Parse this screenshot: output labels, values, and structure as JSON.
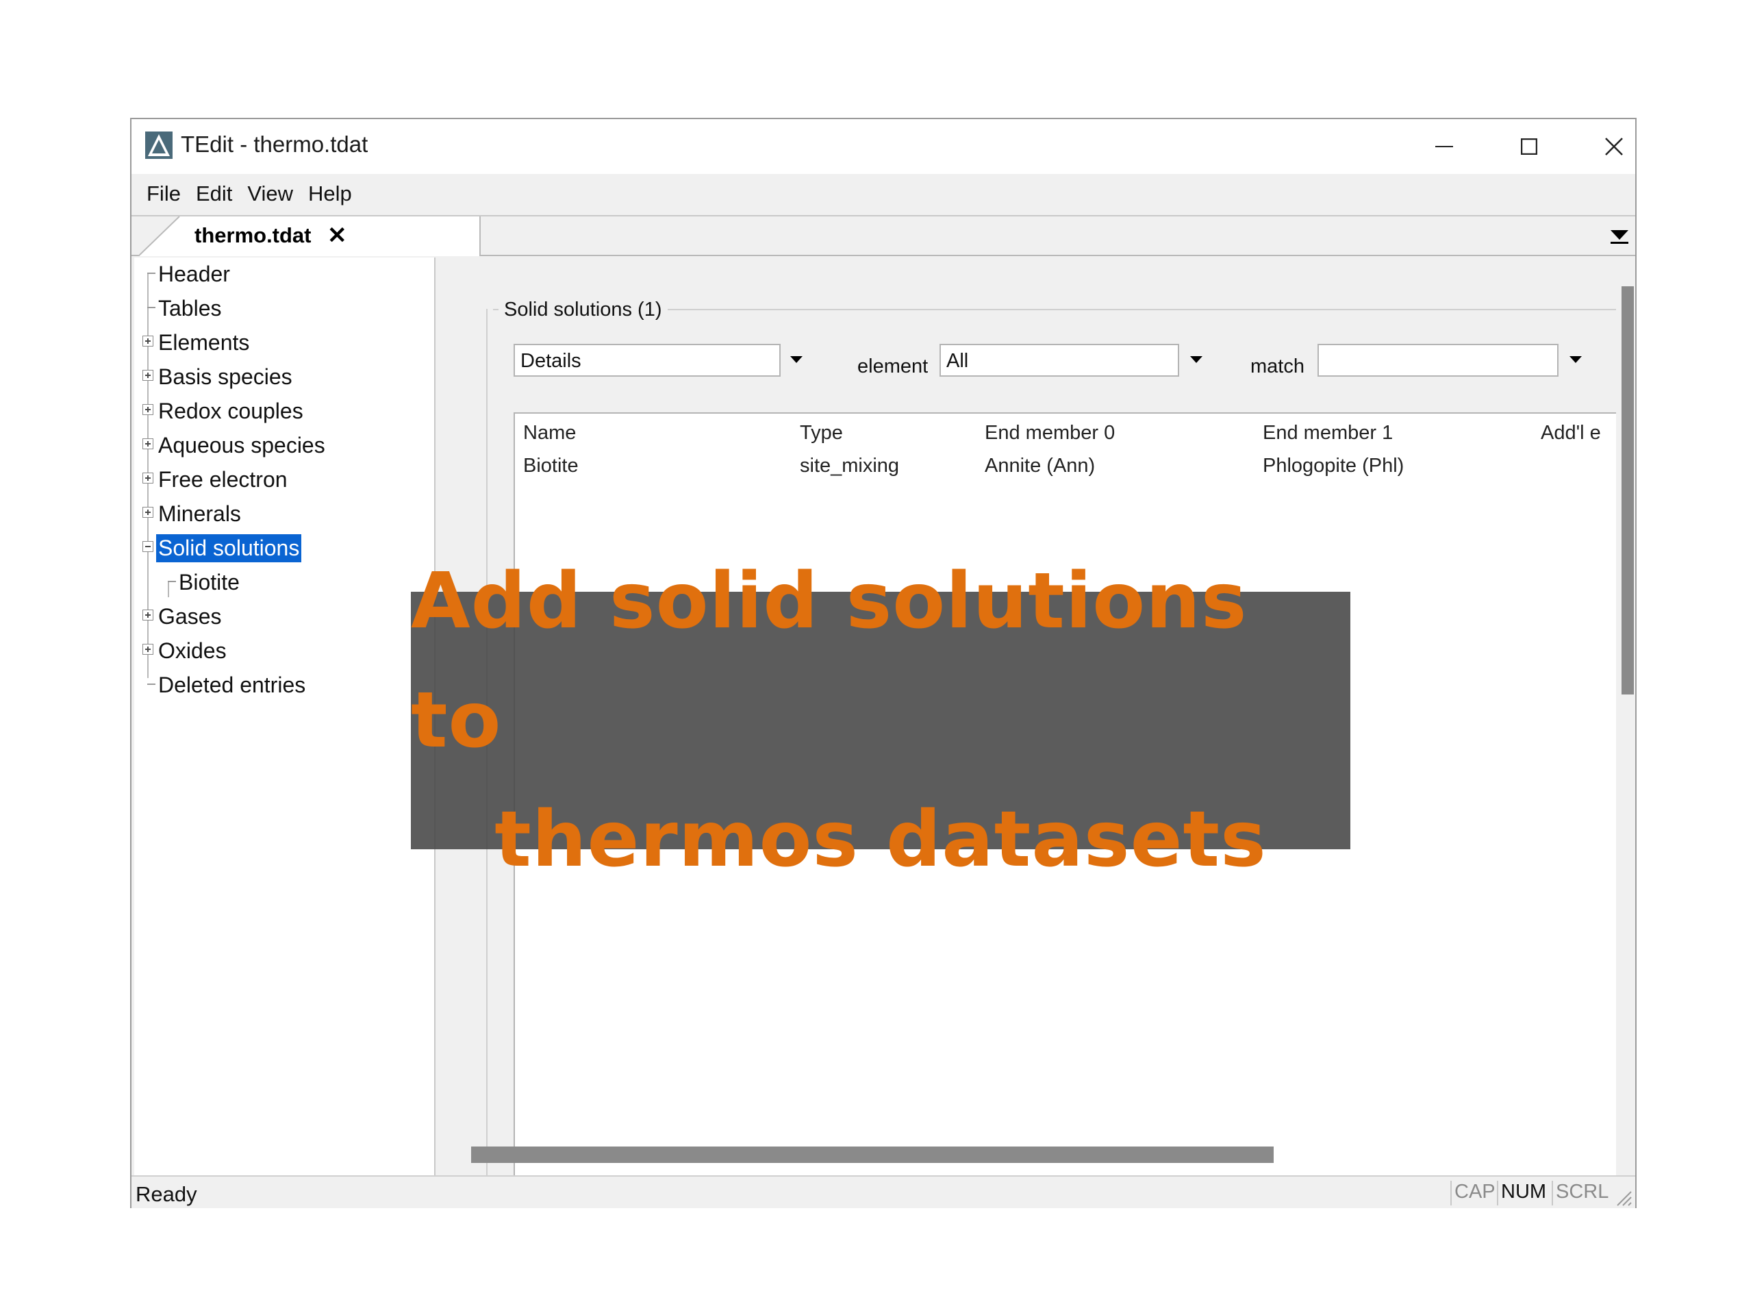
{
  "window": {
    "title": "TEdit - thermo.tdat",
    "menu": [
      "File",
      "Edit",
      "View",
      "Help"
    ],
    "tab": {
      "label": "thermo.tdat",
      "close": "✕"
    }
  },
  "tree": {
    "items": [
      {
        "label": "Header",
        "expandable": false
      },
      {
        "label": "Tables",
        "expandable": false
      },
      {
        "label": "Elements",
        "expandable": true
      },
      {
        "label": "Basis species",
        "expandable": true
      },
      {
        "label": "Redox couples",
        "expandable": true
      },
      {
        "label": "Aqueous species",
        "expandable": true
      },
      {
        "label": "Free electron",
        "expandable": true
      },
      {
        "label": "Minerals",
        "expandable": true
      },
      {
        "label": "Solid solutions",
        "expandable": true,
        "expanded": true,
        "selected": true
      },
      {
        "label": "Biotite",
        "child": true
      },
      {
        "label": "Gases",
        "expandable": true
      },
      {
        "label": "Oxides",
        "expandable": true
      },
      {
        "label": "Deleted entries",
        "expandable": false
      }
    ]
  },
  "panel": {
    "group_title": "Solid solutions (1)",
    "view_select": "Details",
    "element_label": "element",
    "element_select": "All",
    "match_label": "match",
    "match_value": "",
    "table": {
      "columns": [
        "Name",
        "Type",
        "End member 0",
        "End member 1",
        "Add'l e"
      ],
      "rows": [
        [
          "Biotite",
          "site_mixing",
          "Annite (Ann)",
          "Phlogopite (Phl)",
          ""
        ]
      ]
    }
  },
  "status": {
    "text": "Ready",
    "indicators": [
      "CAP",
      "NUM",
      "SCRL"
    ]
  },
  "banner": {
    "line1": "Add solid solutions to",
    "line2": "thermos datasets"
  },
  "colors": {
    "selection": "#0a64d2",
    "banner_text": "#e0700e",
    "banner_bg": "#464646"
  }
}
